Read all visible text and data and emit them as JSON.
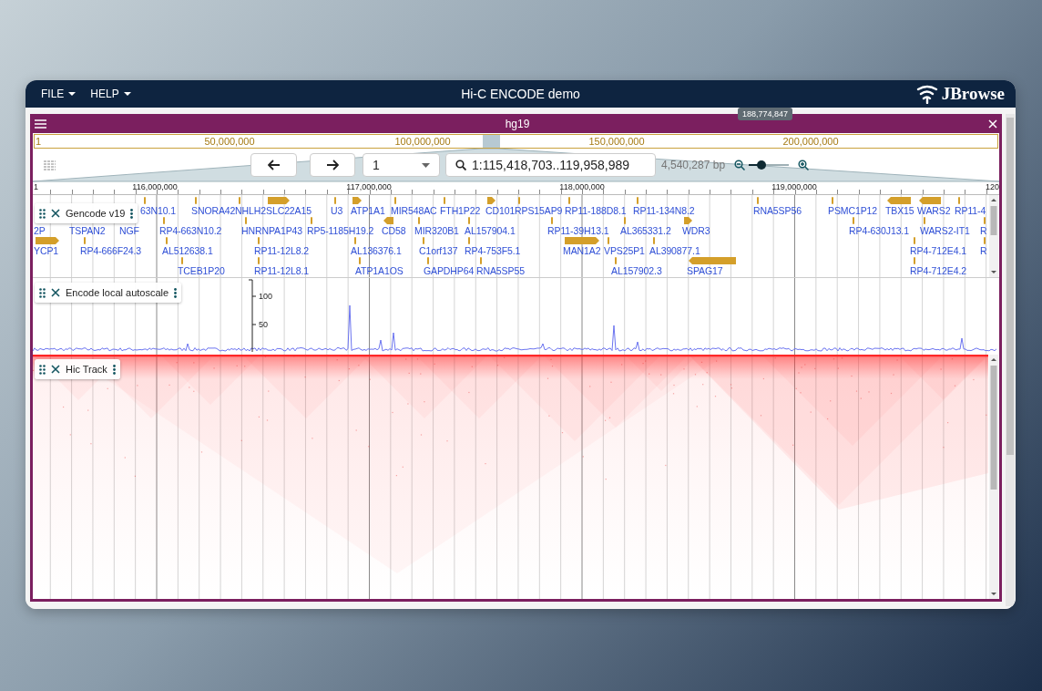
{
  "app": {
    "menus": [
      {
        "label": "FILE"
      },
      {
        "label": "HELP"
      }
    ],
    "title": "Hi-C ENCODE demo",
    "logo": "JBrowse"
  },
  "view": {
    "assembly": "hg19",
    "overview": {
      "labels": [
        "1",
        "50,000,000",
        "100,000,000",
        "150,000,000",
        "200,000,000"
      ],
      "tooltip": "188,774,847"
    },
    "nav": {
      "refname": "1",
      "locstring": "1:115,418,703..119,958,989",
      "span": "4,540,287 bp",
      "zoom": {
        "level": 0.32
      }
    },
    "ruler": {
      "labels": [
        "1",
        "116,000,000",
        "117,000,000",
        "118,000,000",
        "119,000,000",
        "120"
      ]
    },
    "tracks": [
      {
        "kind": "features",
        "name": "Gencode v19",
        "features": [
          "63N10.1",
          "SNORA42",
          "NHLH2",
          "SLC22A15",
          "U3",
          "ATP1A1",
          "MIR548AC",
          "FTH1P22",
          "CD101",
          "RPS15AP9",
          "RP11-188D8.1",
          "RP11-134N8.2",
          "RNA5SP56",
          "PSMC1P12",
          "TBX15",
          "WARS2",
          "RP11-4",
          "2P",
          "TSPAN2",
          "NGF",
          "RP4-663N10.2",
          "HNRNPA1P43",
          "RP5-1185H19.2",
          "CD58",
          "MIR320B1",
          "AL157904.1",
          "RP11-39H13.1",
          "AL365331.2",
          "WDR3",
          "RP4-630J13.1",
          "WARS2-IT1",
          "R",
          "YCP1",
          "RP4-666F24.3",
          "AL512638.1",
          "RP11-12L8.2",
          "AL136376.1",
          "C1orf137",
          "RP4-753F5.1",
          "MAN1A2",
          "VPS25P1",
          "AL390877.1",
          "RP4-712E4.1",
          "R",
          "TCEB1P20",
          "RP11-12L8.1",
          "ATP1A1OS",
          "GAPDHP64",
          "RNA5SP55",
          "AL157902.3",
          "SPAG17",
          "RP4-712E4.2"
        ]
      },
      {
        "kind": "wiggle",
        "name": "Encode local autoscale",
        "ticks": [
          "100",
          "50"
        ]
      },
      {
        "kind": "hic",
        "name": "Hic Track"
      }
    ]
  }
}
